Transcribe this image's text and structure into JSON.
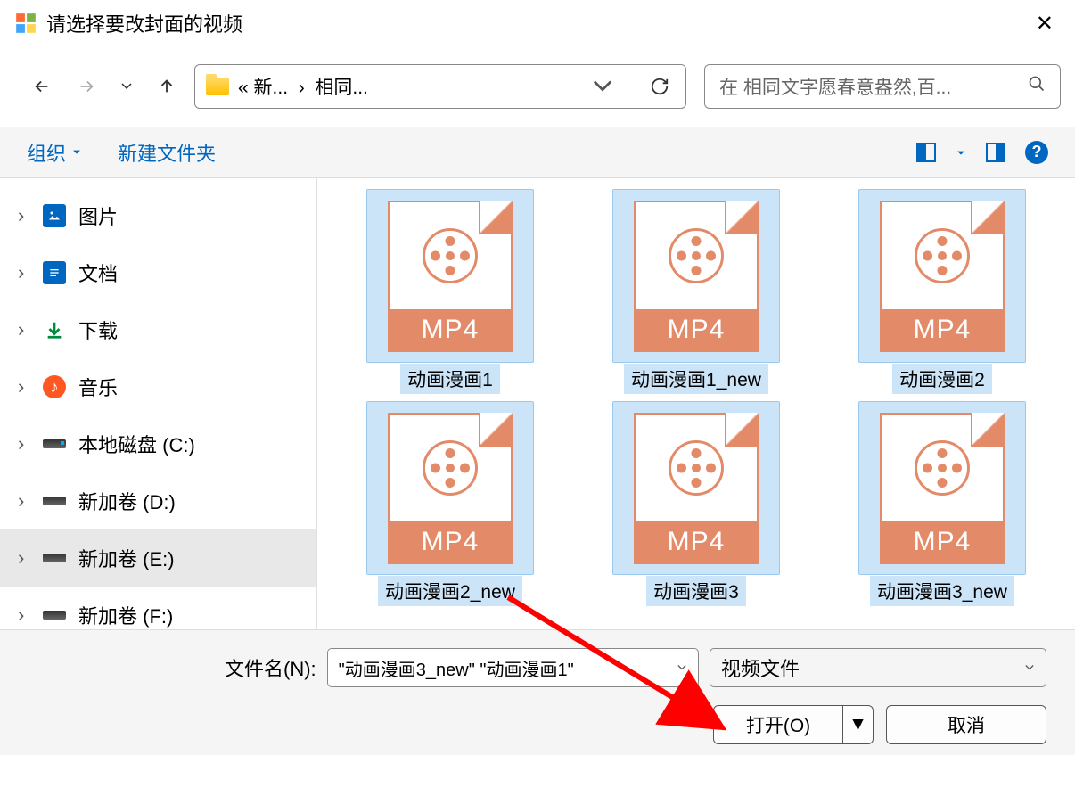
{
  "window": {
    "title": "请选择要改封面的视频"
  },
  "path": {
    "prefix": "«",
    "part1": "新...",
    "sep": "›",
    "part2": "相同..."
  },
  "search": {
    "placeholder": "在 相同文字愿春意盎然,百..."
  },
  "toolbar": {
    "organize": "组织",
    "newfolder": "新建文件夹"
  },
  "tree": [
    {
      "label": "图片",
      "icon": "pic"
    },
    {
      "label": "文档",
      "icon": "doc"
    },
    {
      "label": "下载",
      "icon": "dl"
    },
    {
      "label": "音乐",
      "icon": "music"
    },
    {
      "label": "本地磁盘 (C:)",
      "icon": "localdisk"
    },
    {
      "label": "新加卷 (D:)",
      "icon": "disk"
    },
    {
      "label": "新加卷 (E:)",
      "icon": "disk",
      "selected": true
    },
    {
      "label": "新加卷 (F:)",
      "icon": "disk"
    }
  ],
  "files": [
    {
      "name": "动画漫画1",
      "selected": true
    },
    {
      "name": "动画漫画1_new",
      "selected": true
    },
    {
      "name": "动画漫画2",
      "selected": true
    },
    {
      "name": "动画漫画2_new",
      "selected": true
    },
    {
      "name": "动画漫画3",
      "selected": true
    },
    {
      "name": "动画漫画3_new",
      "selected": true
    }
  ],
  "mp4_label": "MP4",
  "bottom": {
    "filename_label": "文件名(N):",
    "filename_value": "\"动画漫画3_new\" \"动画漫画1\"",
    "filetype": "视频文件",
    "open": "打开(O)",
    "cancel": "取消"
  }
}
